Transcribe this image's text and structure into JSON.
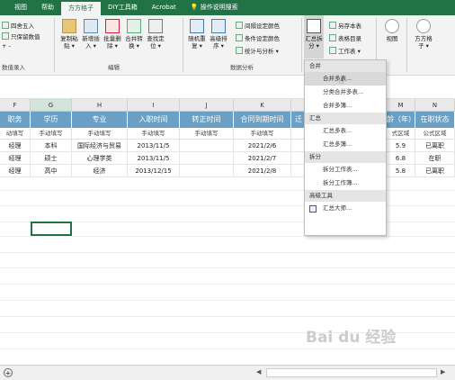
{
  "tabs": [
    "视图",
    "帮助",
    "方方格子",
    "DIY工具箱",
    "Acrobat",
    "操作说明搜索"
  ],
  "ribbon": {
    "left_items": [
      "四舍五入",
      "只保留数值",
      "+ -"
    ],
    "left_group": "数值录入",
    "buttons": [
      {
        "line1": "复制粘",
        "line2": "贴 ▾"
      },
      {
        "line1": "新增插",
        "line2": "入 ▾"
      },
      {
        "line1": "批量删",
        "line2": "除 ▾"
      },
      {
        "line1": "合并转",
        "line2": "换 ▾"
      },
      {
        "line1": "查找定",
        "line2": "位 ▾"
      },
      {
        "line1": "随机重",
        "line2": "复 ▾"
      },
      {
        "line1": "高级排",
        "line2": "序 ▾"
      }
    ],
    "edit_group": "编辑",
    "color_items": [
      "间隔设定颜色",
      "条件设定颜色",
      "统计与分析 ▾"
    ],
    "analysis_group": "数据分析",
    "summary_btn": {
      "line1": "汇总拆",
      "line2": "分 ▾"
    },
    "right_items": [
      "另存本表",
      "表格目录",
      "工作表 ▾"
    ],
    "view_btn": "视图",
    "ffgz_btn": {
      "line1": "方方格",
      "line2": "子 ▾"
    }
  },
  "columns": [
    "F",
    "G",
    "H",
    "I",
    "J",
    "K",
    "",
    "M",
    "N"
  ],
  "headers": [
    "职务",
    "学历",
    "专业",
    "入职时间",
    "转正时间",
    "合同到期时间",
    "迁",
    "龄（年）",
    "在职状态"
  ],
  "subrow": [
    "动填写",
    "手动填写",
    "手动填写",
    "手动填写",
    "手动填写",
    "手动填写",
    "",
    "式区域",
    "公式区域"
  ],
  "rows": [
    [
      "经理",
      "本科",
      "国际经济与贸易",
      "2013/11/5",
      "",
      "2021/2/6",
      "",
      "5.9",
      "已离职"
    ],
    [
      "经理",
      "硕士",
      "心理学类",
      "2013/11/5",
      "",
      "2021/2/7",
      "",
      "6.8",
      "在职"
    ],
    [
      "经理",
      "高中",
      "经济",
      "2013/12/15",
      "",
      "2021/2/8",
      "",
      "5.8",
      "已离职"
    ]
  ],
  "menu": {
    "sections": [
      {
        "title": "合并",
        "items": [
          "合并多表...",
          "分类合并多表...",
          "合并多簿..."
        ]
      },
      {
        "title": "汇总",
        "items": [
          "汇总多表...",
          "汇总多簿..."
        ]
      },
      {
        "title": "拆分",
        "items": [
          "拆分工作表...",
          "拆分工作簿..."
        ]
      },
      {
        "title": "高级工具",
        "items": [
          "汇总大师..."
        ]
      }
    ],
    "highlighted": "合并多表..."
  },
  "watermark": "Bai du 经验"
}
